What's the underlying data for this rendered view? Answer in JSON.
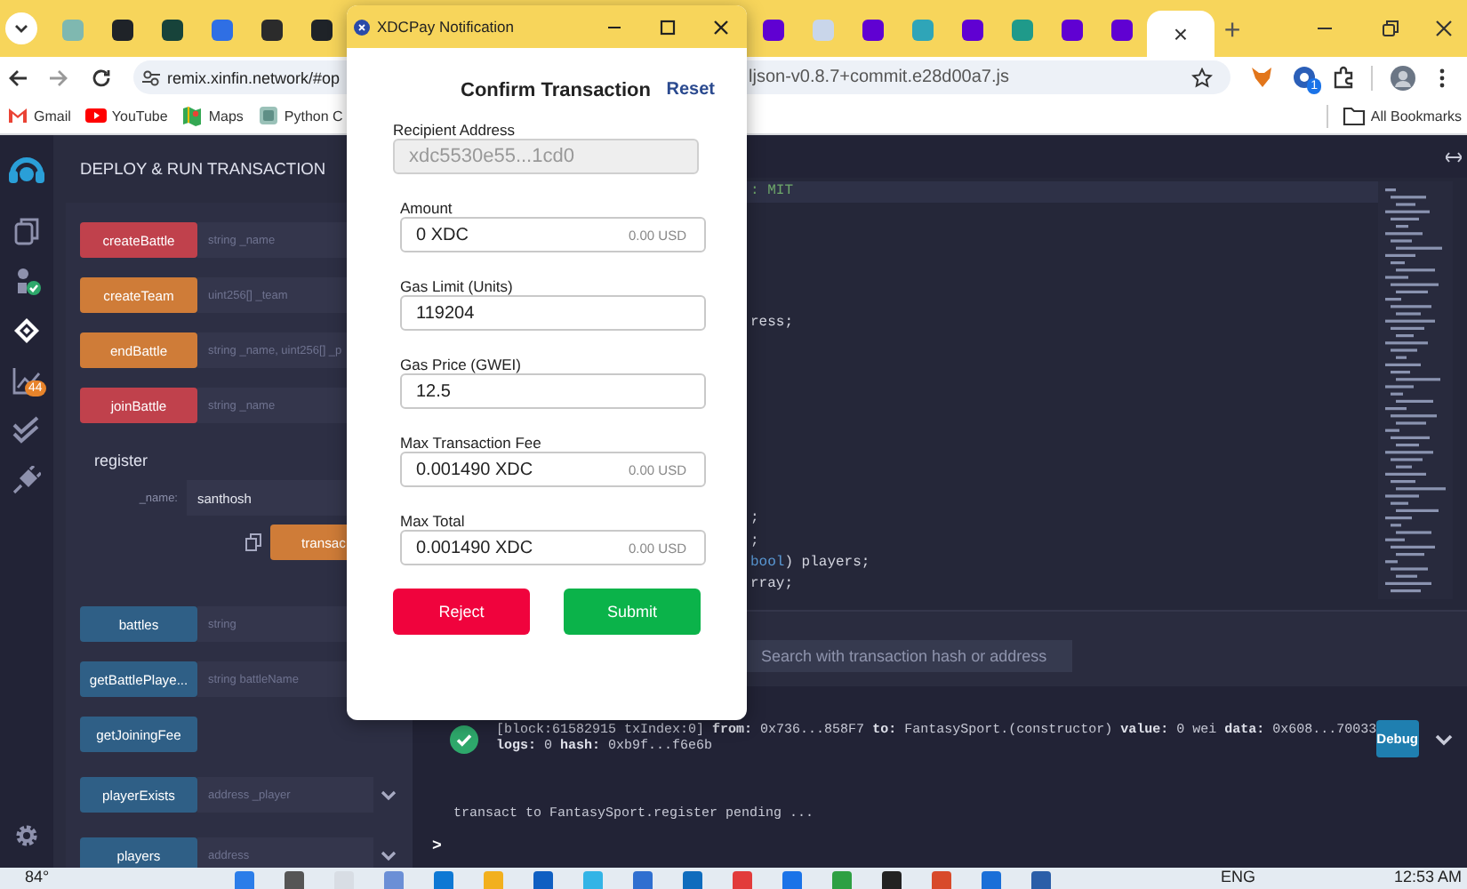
{
  "browser": {
    "tabs": [
      {
        "color": "#7fb8b0",
        "selected": false
      },
      {
        "color": "#1f2328",
        "selected": false
      },
      {
        "color": "#17433a",
        "selected": false
      },
      {
        "color": "#2f6fe4",
        "selected": false
      },
      {
        "color": "#2b2b2b",
        "selected": false
      },
      {
        "color": "#1f2328",
        "selected": false
      },
      {
        "color": "#6001d2",
        "selected": false
      },
      {
        "color": "#c9d6ea",
        "selected": false
      },
      {
        "color": "#6001d2",
        "selected": false
      },
      {
        "color": "#2fa5b8",
        "selected": false
      },
      {
        "color": "#6001d2",
        "selected": false
      },
      {
        "color": "#1f9a8a",
        "selected": false
      },
      {
        "color": "#6001d2",
        "selected": false
      },
      {
        "color": "#6001d2",
        "selected": false
      },
      {
        "selected": true,
        "close": "×"
      }
    ],
    "new_tab": "+",
    "url": {
      "start": "remix.xinfin.network/#op",
      "end": "ljson-v0.8.7+commit.e28d00a7.js"
    },
    "extension_badge": "1",
    "bookmarks": [
      {
        "kind": "mail",
        "label": "Gmail"
      },
      {
        "kind": "video",
        "label": "YouTube"
      },
      {
        "kind": "map",
        "label": "Maps"
      },
      {
        "kind": "python",
        "label": "Python C"
      }
    ],
    "all_bookmarks": "All Bookmarks"
  },
  "rail": [
    {
      "kind": "files",
      "selected": false
    },
    {
      "kind": "compiler",
      "selected": false
    },
    {
      "kind": "deploy",
      "selected": true
    },
    {
      "kind": "analysis",
      "selected": false,
      "badge": "44"
    },
    {
      "kind": "tests",
      "selected": false
    },
    {
      "kind": "plugins",
      "selected": false
    }
  ],
  "panel": {
    "title": "DEPLOY & RUN TRANSACTION",
    "functions": [
      {
        "name": "createBattle",
        "kind": "payable",
        "placeholder": "string _name",
        "expanded": false
      },
      {
        "name": "createTeam",
        "kind": "transact",
        "placeholder": "uint256[] _team",
        "expanded": false
      },
      {
        "name": "endBattle",
        "kind": "transact",
        "placeholder": "string _name, uint256[] _p",
        "expanded": false
      },
      {
        "name": "joinBattle",
        "kind": "payable",
        "placeholder": "string _name",
        "expanded": false
      },
      {
        "name": "register",
        "kind": "transact",
        "expanded": true,
        "params": [
          {
            "label": "_name:",
            "value": "santhosh"
          }
        ],
        "button": "transac"
      },
      {
        "name": "battles",
        "kind": "call",
        "placeholder": "string",
        "expanded": false
      },
      {
        "name": "getBattlePlaye...",
        "kind": "call",
        "placeholder": "string battleName",
        "expanded": false
      },
      {
        "name": "getJoiningFee",
        "kind": "call",
        "expanded": false
      },
      {
        "name": "playerExists",
        "kind": "call",
        "placeholder": "address _player",
        "expanded": false,
        "collapsible": true
      },
      {
        "name": "players",
        "kind": "call",
        "placeholder": "address",
        "expanded": false,
        "collapsible": true
      }
    ]
  },
  "editor": {
    "code": [
      {
        "segments": [
          {
            "text": ": MIT",
            "kind": "comment"
          }
        ]
      },
      {
        "segments": [
          {
            "text": "ress;",
            "kind": "plain"
          }
        ]
      },
      {
        "segments": [
          {
            "text": ";",
            "kind": "plain"
          }
        ]
      },
      {
        "segments": [
          {
            "text": ";",
            "kind": "plain"
          }
        ]
      },
      {
        "segments": [
          {
            "text": "bool",
            "kind": "type"
          },
          {
            "text": ") players;",
            "kind": "plain"
          }
        ]
      },
      {
        "segments": [
          {
            "text": "rray;",
            "kind": "plain"
          }
        ]
      }
    ]
  },
  "terminal": {
    "search_placeholder": "Search with transaction hash or address",
    "log": {
      "success": true,
      "lines": [
        "[block:61582915 txIndex:0] **from:** 0x736...858F7 **to:** FantasySport.(constructor) **value:** 0 wei **data:** 0x608...70033",
        "**logs:** 0 **hash:** 0xb9f...f6e6b"
      ],
      "debug": "Debug"
    },
    "pending": "transact to FantasySport.register pending ...",
    "prompt": ">"
  },
  "popup": {
    "title": "XDCPay Notification",
    "heading": "Confirm Transaction",
    "reset": "Reset",
    "fields": [
      {
        "label": "Recipient Address",
        "value": "xdc5530e55...1cd0",
        "disabled": true
      },
      {
        "label": "Amount",
        "value": "0 XDC",
        "usd": "0.00 USD",
        "disabled": false
      },
      {
        "label": "Gas Limit (Units)",
        "value": "119204",
        "disabled": false
      },
      {
        "label": "Gas Price (GWEI)",
        "value": "12.5",
        "disabled": false
      },
      {
        "label": "Max Transaction Fee",
        "value": "0.001490 XDC",
        "usd": "0.00 USD",
        "disabled": false
      },
      {
        "label": "Max Total",
        "value": "0.001490 XDC",
        "usd": "0.00 USD",
        "disabled": false
      }
    ],
    "buttons": [
      {
        "label": "Reject",
        "kind": "reject"
      },
      {
        "label": "Submit",
        "kind": "submit"
      }
    ]
  },
  "taskbar": {
    "weather": "84°",
    "apps": [
      {
        "color": "#2b7de9"
      },
      {
        "color": "#555555"
      },
      {
        "color": "#d8dde4"
      },
      {
        "color": "#6b8fd6"
      },
      {
        "color": "#0e78d4"
      },
      {
        "color": "#f2b01e"
      },
      {
        "color": "#0f5fc2"
      },
      {
        "color": "#33b4e6"
      },
      {
        "color": "#2f6fd0"
      },
      {
        "color": "#0f6cbd"
      },
      {
        "color": "#e23b3b"
      },
      {
        "color": "#1a73e8"
      },
      {
        "color": "#2ea043"
      },
      {
        "color": "#222222"
      },
      {
        "color": "#d84a2b"
      },
      {
        "color": "#1a6fd8"
      },
      {
        "color": "#2b5ea8"
      }
    ],
    "language": "ENG",
    "time": "12:53 AM"
  }
}
